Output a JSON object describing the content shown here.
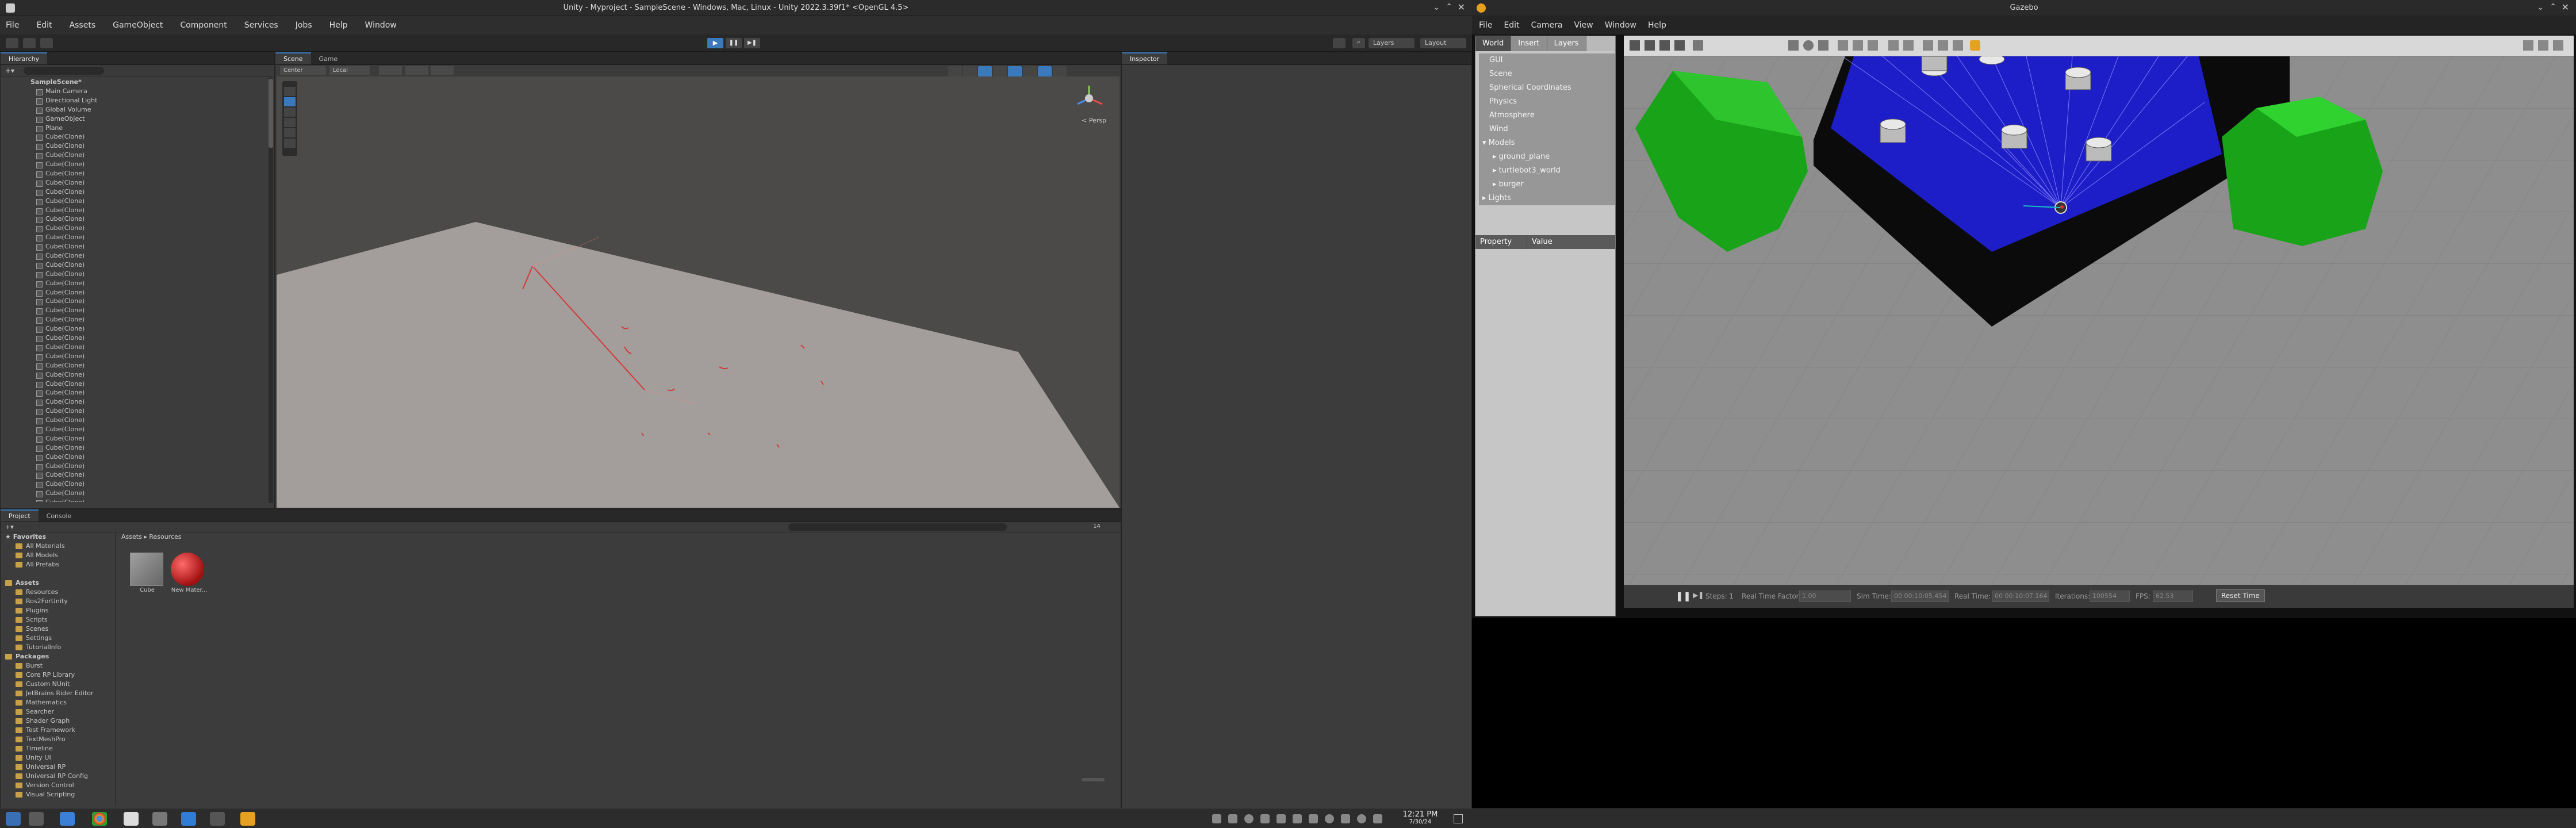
{
  "unity": {
    "title": "Unity - Myproject - SampleScene - Windows, Mac, Linux - Unity 2022.3.39f1* <OpenGL 4.5>",
    "menu": [
      "File",
      "Edit",
      "Assets",
      "GameObject",
      "Component",
      "Services",
      "Jobs",
      "Help",
      "Window"
    ],
    "toolbar": {
      "layers": "Layers",
      "layout": "Layout"
    },
    "hierarchy": {
      "tab": "Hierarchy",
      "scene": "SampleScene*",
      "items": [
        "Main Camera",
        "Directional Light",
        "Global Volume",
        "GameObject",
        "Plane"
      ],
      "clone_label": "Cube(Clone)",
      "clone_count": 41
    },
    "scene": {
      "tabs": [
        "Scene",
        "Game"
      ],
      "tools": [
        "Center",
        "Local"
      ],
      "persp_label": "< Persp"
    },
    "inspector": {
      "tab": "Inspector"
    },
    "project": {
      "tabs": [
        "Project",
        "Console"
      ],
      "breadcrumb": [
        "Assets",
        "Resources"
      ],
      "favorites": {
        "label": "Favorites",
        "items": [
          "All Materials",
          "All Models",
          "All Prefabs"
        ]
      },
      "assets": {
        "label": "Assets",
        "items": [
          "Resources",
          "Ros2ForUnity",
          "Plugins",
          "Scripts",
          "Scenes",
          "Settings",
          "TutorialInfo"
        ]
      },
      "packages": {
        "label": "Packages",
        "items": [
          "Burst",
          "Core RP Library",
          "Custom NUnit",
          "JetBrains Rider Editor",
          "Mathematics",
          "Searcher",
          "Shader Graph",
          "Test Framework",
          "TextMeshPro",
          "Timeline",
          "Unity UI",
          "Universal RP",
          "Universal RP Config",
          "Version Control",
          "Visual Scripting"
        ]
      },
      "files": [
        {
          "name": "Cube",
          "color": "#8a8a8a"
        },
        {
          "name": "New Mater...",
          "color": "#c42222"
        }
      ],
      "count": "14"
    }
  },
  "gazebo": {
    "title": "Gazebo",
    "menu": [
      "File",
      "Edit",
      "Camera",
      "View",
      "Window",
      "Help"
    ],
    "tabs": [
      "World",
      "Insert",
      "Layers"
    ],
    "tree": [
      "GUI",
      "Scene",
      "Spherical Coordinates",
      "Physics",
      "Atmosphere",
      "Wind",
      "Models",
      "ground_plane",
      "turtlebot3_world",
      "burger",
      "Lights"
    ],
    "prop_header": [
      "Property",
      "Value"
    ],
    "bottom": {
      "steps": "Steps: 1",
      "rtf_label": "Real Time Factor:",
      "rtf": "1.00",
      "sim_label": "Sim Time:",
      "sim": "00 00:10:05.454",
      "real_label": "Real Time:",
      "real": "00 00:10:07.164",
      "iter_label": "Iterations:",
      "iter": "100554",
      "fps_label": "FPS:",
      "fps": "62.53",
      "reset": "Reset Time"
    }
  },
  "taskbar": {
    "time": "12:21 PM",
    "date": "7/30/24"
  },
  "colors": {
    "unity_bg": "#383838",
    "accent_blue": "#3a79bb",
    "laser_red": "#e03030",
    "gz_green": "#1aa51a",
    "gz_blue": "#2a2ad8"
  }
}
